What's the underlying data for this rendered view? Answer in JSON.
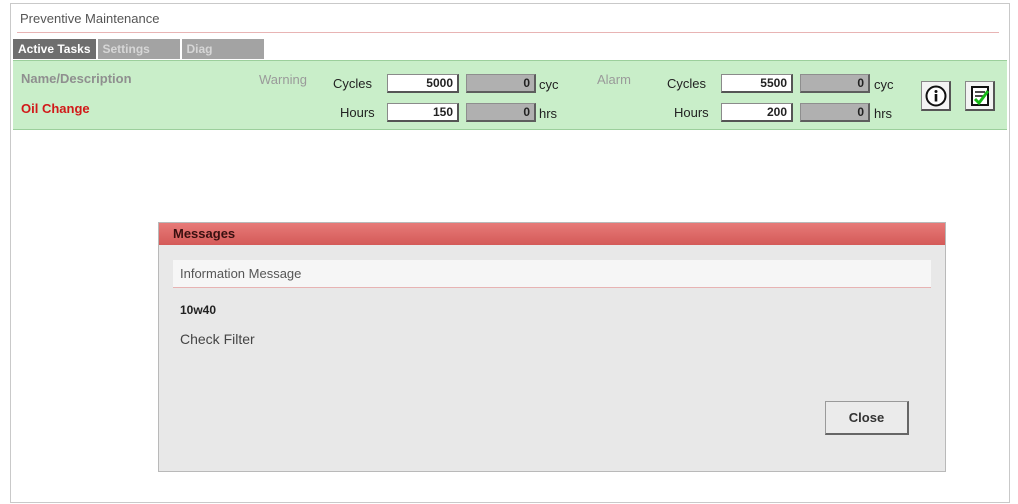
{
  "window": {
    "title": "Preventive Maintenance"
  },
  "tabs": [
    {
      "label": "Active Tasks",
      "active": true
    },
    {
      "label": "Settings",
      "active": false
    },
    {
      "label": "Diag",
      "active": false
    }
  ],
  "task": {
    "header_name": "Name/Description",
    "name": "Oil Change",
    "warning": {
      "label": "Warning",
      "cycles_label": "Cycles",
      "cycles_value": "5000",
      "cycles_current": "0",
      "cycles_unit": "cyc",
      "hours_label": "Hours",
      "hours_value": "150",
      "hours_current": "0",
      "hours_unit": "hrs"
    },
    "alarm": {
      "label": "Alarm",
      "cycles_label": "Cycles",
      "cycles_value": "5500",
      "cycles_current": "0",
      "cycles_unit": "cyc",
      "hours_label": "Hours",
      "hours_value": "200",
      "hours_current": "0",
      "hours_unit": "hrs"
    },
    "icons": {
      "info": "info-icon",
      "checklist": "checklist-icon"
    }
  },
  "dialog": {
    "title": "Messages",
    "subtitle": "Information Message",
    "line1": "10w40",
    "line2": "Check Filter",
    "close_label": "Close"
  },
  "colors": {
    "task_bg": "#c9eec9",
    "alert_red": "#d11919",
    "dialog_header": "#d45a58"
  }
}
